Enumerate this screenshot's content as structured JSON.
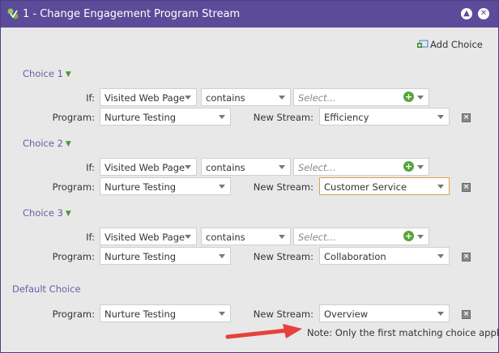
{
  "dialog": {
    "title": "1 - Change Engagement Program Stream",
    "add_choice_label": "Add Choice",
    "accent_color": "#5c4b98"
  },
  "labels": {
    "if": "If:",
    "program": "Program:",
    "new_stream": "New Stream:"
  },
  "choices": [
    {
      "title": "Choice 1",
      "trigger": "Visited Web Page",
      "operator": "contains",
      "value_placeholder": "Select...",
      "program": "Nurture Testing",
      "stream": "Efficiency"
    },
    {
      "title": "Choice 2",
      "trigger": "Visited Web Page",
      "operator": "contains",
      "value_placeholder": "Select...",
      "program": "Nurture Testing",
      "stream": "Customer Service"
    },
    {
      "title": "Choice 3",
      "trigger": "Visited Web Page",
      "operator": "contains",
      "value_placeholder": "Select...",
      "program": "Nurture Testing",
      "stream": "Collaboration"
    }
  ],
  "default_choice": {
    "title": "Default Choice",
    "program": "Nurture Testing",
    "stream": "Overview"
  },
  "note": "Note: Only the first matching choice applies",
  "icons": [
    "flow-step-icon",
    "collapse-icon",
    "close-icon",
    "add-choice-icon",
    "chevron-down-icon",
    "add-value-icon",
    "delete-choice-icon",
    "red-arrow-annotation"
  ]
}
